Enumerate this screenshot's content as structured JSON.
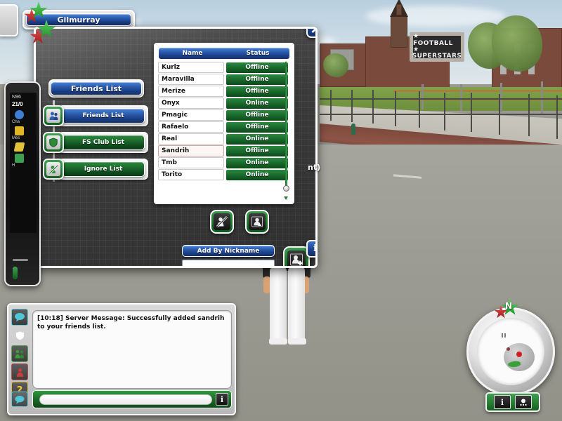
{
  "game": {
    "title": "Football Superstars",
    "billboard_line1": "★ FOOTBALL ★",
    "billboard_line2": "SUPERSTARS",
    "player_nameplate": "Gilmurray",
    "world_label_fragment": "nt)"
  },
  "friends_dialog": {
    "title": "Friends List",
    "close_label": "X",
    "info_label": "i",
    "tabs": [
      {
        "label": "Friends List",
        "icon": "friends-icon",
        "active": true
      },
      {
        "label": "FS Club List",
        "icon": "club-shield-icon",
        "active": false
      },
      {
        "label": "Ignore List",
        "icon": "ignore-icon",
        "active": false
      }
    ],
    "table": {
      "columns": [
        "Name",
        "Status"
      ],
      "rows": [
        {
          "name": "Kurlz",
          "status": "Offline",
          "highlight": false
        },
        {
          "name": "Maravilla",
          "status": "Offline",
          "highlight": false
        },
        {
          "name": "Merize",
          "status": "Offline",
          "highlight": false
        },
        {
          "name": "Onyx",
          "status": "Online",
          "highlight": false
        },
        {
          "name": "Pmagic",
          "status": "Offline",
          "highlight": false
        },
        {
          "name": "Rafaelo",
          "status": "Offline",
          "highlight": false
        },
        {
          "name": "Real",
          "status": "Online",
          "highlight": false
        },
        {
          "name": "Sandrih",
          "status": "Offline",
          "highlight": true
        },
        {
          "name": "Tmb",
          "status": "Online",
          "highlight": false
        },
        {
          "name": "Torito",
          "status": "Online",
          "highlight": false
        }
      ]
    },
    "actions": [
      {
        "name": "remove-friend-button",
        "icon": "person-slash-icon"
      },
      {
        "name": "view-profile-button",
        "icon": "person-card-icon"
      }
    ],
    "add_by_nickname": {
      "label": "Add By Nickname",
      "input_value": "",
      "input_placeholder": "",
      "submit_icon": "person-plus-icon"
    }
  },
  "phone": {
    "brand": "N96",
    "date": "21/0",
    "item1_label": "Cha",
    "item2_label": "Mes",
    "item3_label": "H"
  },
  "chat": {
    "messages": [
      "[10:18] Server Message: Successfully added sandrih to your friends list."
    ],
    "input_value": "",
    "input_placeholder": "",
    "send_label": "i",
    "channel_icons": [
      {
        "name": "chat-bubble-icon",
        "glyph": "bubble",
        "color": "#4fc6d8"
      },
      {
        "name": "white-shield-icon",
        "glyph": "shield",
        "color": "#ffffff"
      },
      {
        "name": "team-people-icon",
        "glyph": "people",
        "color": "#3aa03a"
      },
      {
        "name": "person-red-icon",
        "glyph": "person",
        "color": "#cc3b3b"
      },
      {
        "name": "help-question-icon",
        "glyph": "question",
        "color": "#e8c23a"
      }
    ]
  },
  "minimap": {
    "compass_label": "N",
    "buttons": [
      {
        "name": "minimap-info-button",
        "label": "i"
      },
      {
        "name": "minimap-expand-button",
        "label": "■"
      }
    ]
  },
  "colors": {
    "blue_button": "#1b3f86",
    "green_button": "#1f6e2f",
    "status_green": "#1c7030",
    "highlight_border": "#c9a49a",
    "chrome_white": "#ffffff"
  }
}
